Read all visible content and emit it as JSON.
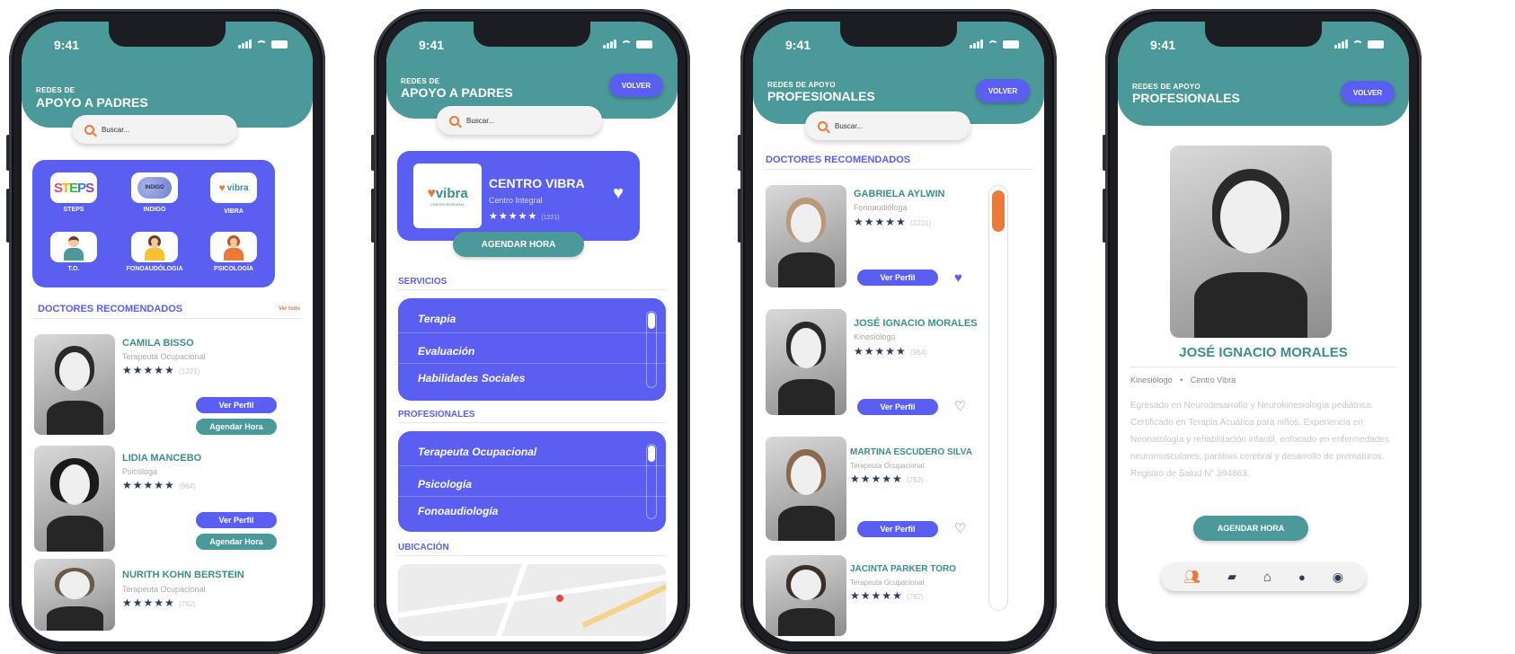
{
  "status": {
    "time": "9:41"
  },
  "screen1": {
    "header_sub": "REDES DE",
    "header_title": "APOYO A PADRES",
    "search_placeholder": "Buscar...",
    "categories": [
      {
        "label": "STEPS",
        "logo": "STEPS",
        "icon": "steps-logo"
      },
      {
        "label": "INDIGO",
        "logo": "INDIGO",
        "icon": "indigo-logo"
      },
      {
        "label": "VIBRA",
        "logo": "vibra",
        "icon": "vibra-logo"
      },
      {
        "label": "T.O.",
        "icon": "occupational-therapy-icon"
      },
      {
        "label": "FONOAUDÓLOGIA",
        "icon": "speech-therapy-icon"
      },
      {
        "label": "PSICOLOGÍA",
        "icon": "psychology-icon"
      }
    ],
    "section_title": "DOCTORES RECOMENDADOS",
    "see_all": "Ver todo",
    "doctors": [
      {
        "name": "CAMILA BISSO",
        "role": "Terapeuta Ocupacional",
        "stars": "★★★★★",
        "count": "(1221)",
        "profile_btn": "Ver Perfil",
        "book_btn": "Agendar Hora"
      },
      {
        "name": "LIDIA MANCEBO",
        "role": "Psicóloga",
        "stars": "★★★★★",
        "count": "(964)",
        "profile_btn": "Ver Perfil",
        "book_btn": "Agendar Hora"
      },
      {
        "name": "NURITH KOHN BERSTEIN",
        "role": "Terapeuta Ocupacional",
        "stars": "★★★★★",
        "count": "(762)"
      }
    ]
  },
  "screen2": {
    "header_sub": "REDES DE",
    "header_title": "APOYO A PADRES",
    "back_btn": "VOLVER",
    "search_placeholder": "Buscar...",
    "center": {
      "logo": "vibra",
      "logo_sub": "CENTRO INTEGRAL",
      "name": "CENTRO VIBRA",
      "type": "Centro Integral",
      "stars": "★★★★★",
      "count": "(1221)"
    },
    "book_btn": "AGENDAR HORA",
    "services_title": "SERVICIOS",
    "services": [
      "Terapia",
      "Evaluación",
      "Habilidades Sociales"
    ],
    "professionals_title": "PROFESIONALES",
    "professionals": [
      "Terapeuta Ocupacional",
      "Psicología",
      "Fonoaudiología"
    ],
    "location_title": "UBICACIÓN"
  },
  "screen3": {
    "header_sub": "REDES DE APOYO",
    "header_title": "PROFESIONALES",
    "back_btn": "VOLVER",
    "search_placeholder": "Buscar...",
    "section_title": "DOCTORES RECOMENDADOS",
    "doctors": [
      {
        "name": "GABRIELA AYLWIN",
        "role": "Fonoaudióloga",
        "stars": "★★★★★",
        "count": "(1221)",
        "profile_btn": "Ver Perfil",
        "favorite": true
      },
      {
        "name": "JOSÉ IGNACIO MORALES",
        "role": "Kinesiólogo",
        "stars": "★★★★★",
        "count": "(964)",
        "profile_btn": "Ver Perfil",
        "favorite": false
      },
      {
        "name": "MARTINA ESCUDERO SILVA",
        "role": "Terapeuta Ocupacional",
        "stars": "★★★★★",
        "count": "(762)",
        "profile_btn": "Ver Perfil",
        "favorite": false
      },
      {
        "name": "JACINTA PARKER TORO",
        "role": "Terapeuta Ocupacional",
        "stars": "★★★★★",
        "count": "(762)"
      }
    ]
  },
  "screen4": {
    "header_sub": "REDES DE APOYO",
    "header_title": "PROFESIONALES",
    "back_btn": "VOLVER",
    "name": "JOSÉ IGNACIO MORALES",
    "role": "Kinesiólogo",
    "center": "Centro Vibra",
    "bio": "Egresado en Neurodesarrollo y Neurokinesiología pediátrica. Certificado en Terapia Acuática para niños. Experiencia en Neonatología y rehabilitación infantil, enfocado en enfermedades neuromusculares, parálisis cerebral y desarrollo de prematuros. Registro de Salud N° 394863.",
    "book_btn": "AGENDAR HORA",
    "nav": [
      "people-icon",
      "book-icon",
      "home-icon",
      "chat-icon",
      "profile-icon"
    ]
  },
  "colors": {
    "teal": "#4b9a99",
    "blue": "#5a5ff2",
    "orange": "#ea7a3a",
    "navy": "#2e3c5a"
  }
}
